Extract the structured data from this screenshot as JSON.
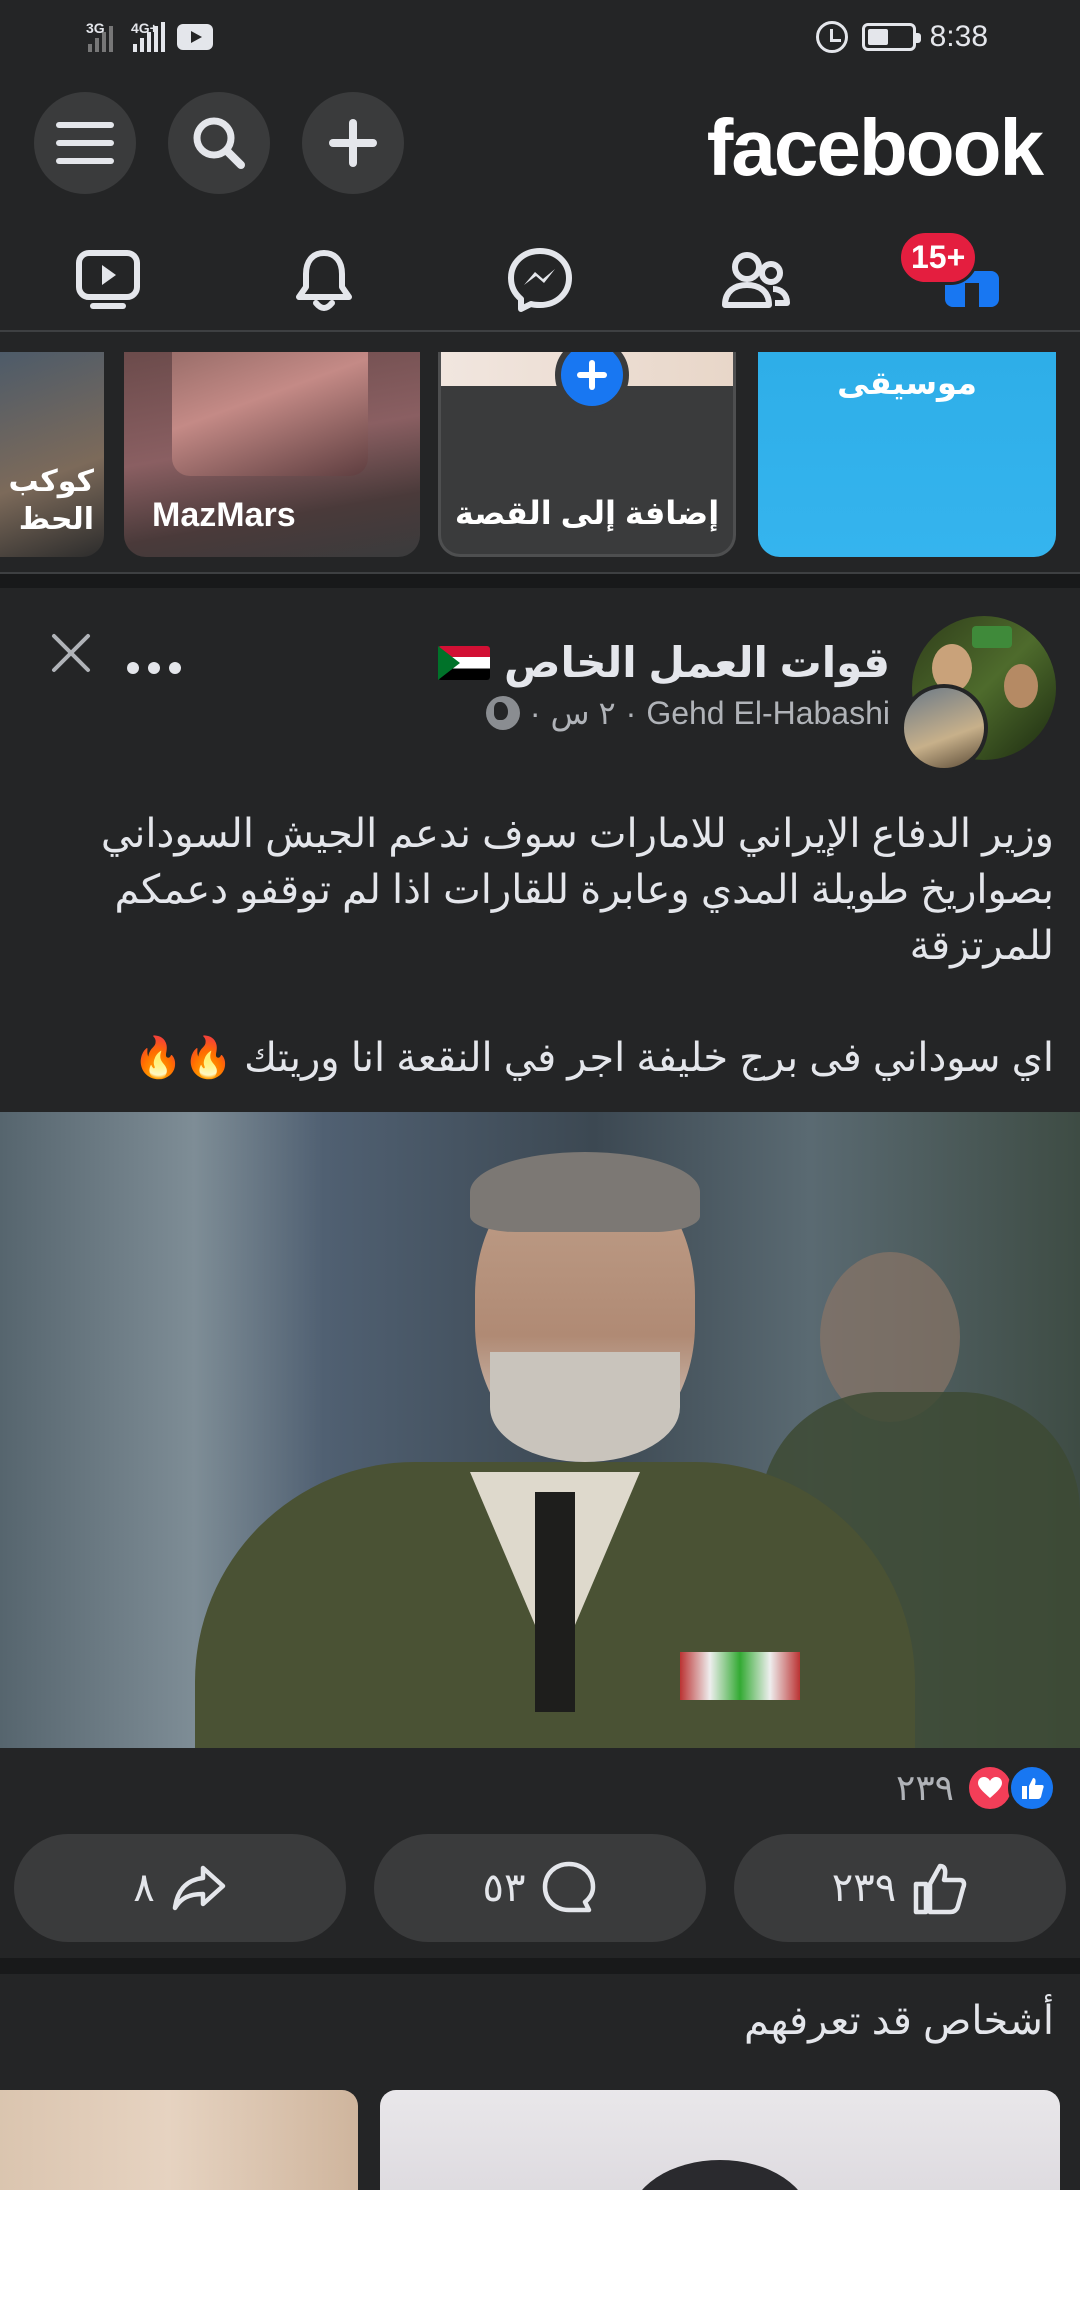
{
  "status_bar": {
    "network1": "3G",
    "network2": "4G+",
    "time": "8:38",
    "icons": [
      "signal-icon",
      "youtube-icon",
      "alarm-icon",
      "battery-icon"
    ]
  },
  "header": {
    "logo": "facebook",
    "buttons": [
      "menu-icon",
      "search-icon",
      "plus-icon"
    ]
  },
  "nav": {
    "items": [
      "video-icon",
      "bell-icon",
      "messenger-icon",
      "friends-icon",
      "marketplace-icon"
    ],
    "badge": "15+"
  },
  "stories": [
    {
      "label": "كوكب الحظ"
    },
    {
      "label": "MazMars"
    },
    {
      "label": "إضافة إلى القصة"
    },
    {
      "label": "موسيقى"
    }
  ],
  "post": {
    "page_name": "قوات العمل الخاص",
    "author": "Gehd El-Habashi",
    "time": "٢ س",
    "separator": "·",
    "text_lines": [
      "وزير الدفاع الإيراني للامارات سوف ندعم الجيش السوداني",
      "بصواريخ طويلة المدي وعابرة للقارات اذا لم توقفو دعمكم",
      "للمرتزقة"
    ],
    "text_line_last": "اي سوداني فى برج خليفة اجر في النقعة انا وريتك 🔥🔥",
    "reactions_count": "٢٣٩",
    "actions": {
      "like": "٢٣٩",
      "comment": "٥٣",
      "share": "٨"
    }
  },
  "pymk": {
    "title": "أشخاص قد تعرفهم"
  },
  "colors": {
    "background": "#242526",
    "accent": "#1877f2",
    "badge": "#e41e3f",
    "story_music": "#2eaee8"
  }
}
